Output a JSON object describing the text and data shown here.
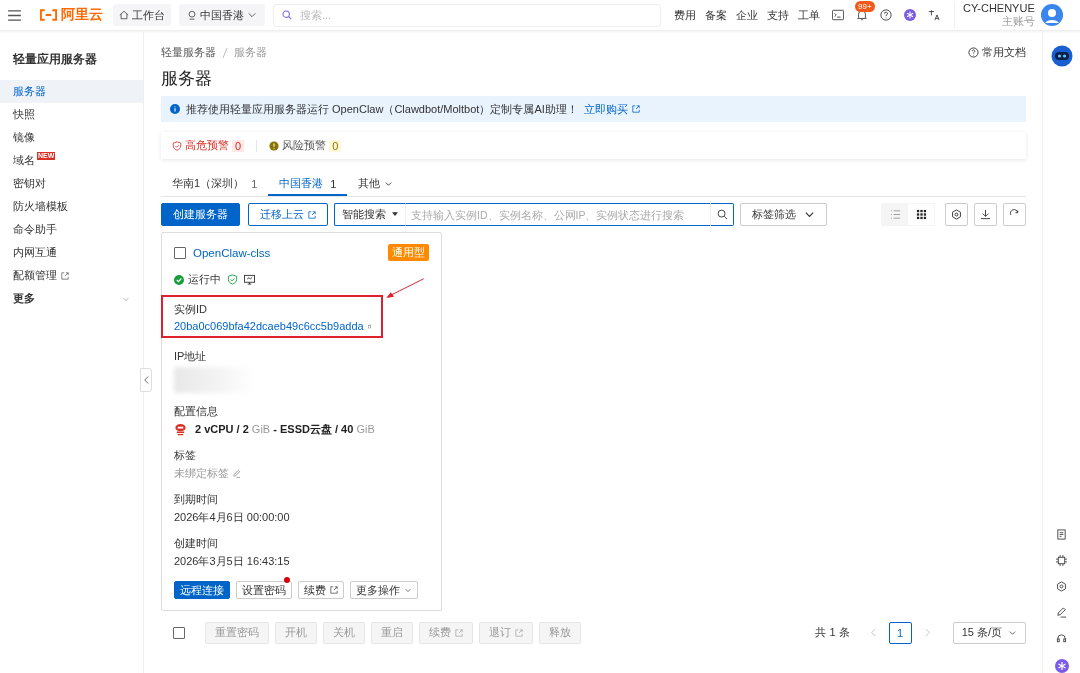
{
  "topbar": {
    "logo": "阿里云",
    "workbench": "工作台",
    "region": "中国香港",
    "search_placeholder": "搜索...",
    "links": [
      "费用",
      "备案",
      "企业",
      "支持",
      "工单"
    ],
    "notification_badge": "99+",
    "user": {
      "name": "CY-CHENYUE",
      "role": "主账号"
    }
  },
  "sidebar": {
    "title": "轻量应用服务器",
    "items": [
      {
        "label": "服务器",
        "selected": true
      },
      {
        "label": "快照",
        "selected": false
      },
      {
        "label": "镜像",
        "selected": false
      },
      {
        "label": "域名",
        "selected": false,
        "badge": "NEW"
      },
      {
        "label": "密钥对",
        "selected": false
      },
      {
        "label": "防火墙模板",
        "selected": false
      },
      {
        "label": "命令助手",
        "selected": false
      },
      {
        "label": "内网互通",
        "selected": false
      },
      {
        "label": "配额管理",
        "selected": false,
        "external": true
      }
    ],
    "more": "更多"
  },
  "breadcrumb": [
    "轻量服务器",
    "服务器"
  ],
  "page_title": "服务器",
  "docs_link": "常用文档",
  "notice": {
    "text": "推荐使用轻量应用服务器运行 OpenClaw（Clawdbot/Moltbot）定制专属AI助理！",
    "link": "立即购买"
  },
  "alerts": [
    {
      "kind": "danger",
      "label": "高危预警",
      "count": "0"
    },
    {
      "kind": "risk",
      "label": "风险预警",
      "count": "0"
    }
  ],
  "region_tabs": [
    {
      "kind": "region",
      "label": "华南1（深圳）",
      "count": "1",
      "selected": false
    },
    {
      "kind": "region",
      "label": "中国香港",
      "count": "1",
      "selected": true
    },
    {
      "kind": "dropdown",
      "label": "其他",
      "selected": false
    }
  ],
  "toolbar": {
    "create": "创建服务器",
    "migrate": "迁移上云",
    "search_mode": "智能搜索",
    "search_placeholder": "支持输入实例ID、实例名称、公网IP、实例状态进行搜索",
    "tag_filter": "标签筛选",
    "views": [
      {
        "kind": "list",
        "selected": false
      },
      {
        "kind": "grid",
        "selected": true
      }
    ]
  },
  "card": {
    "checked": false,
    "name": "OpenClaw-clss",
    "type_tag": "通用型",
    "status": "运行中",
    "instance_id_label": "实例ID",
    "instance_id": "20ba0c069bfa42dcaeb49c6cc5b9adda",
    "ip_label": "IP地址",
    "config_label": "配置信息",
    "config": "**2 vCPU / 2** GiB **- ESSD云盘 / 40** GiB",
    "tags_label": "标签",
    "tags_value": "未绑定标签",
    "expire_label": "到期时间",
    "expire": "2026年4月6日 00:00:00",
    "created_label": "创建时间",
    "created": "2026年3月5日 16:43:15",
    "buttons": [
      {
        "kind": "primary",
        "label": "远程连接"
      },
      {
        "kind": "notified",
        "label": "设置密码"
      },
      {
        "kind": "external",
        "label": "续费"
      },
      {
        "kind": "dropdown",
        "label": "更多操作"
      }
    ]
  },
  "select_all": {
    "checked": false
  },
  "bulk_actions": [
    {
      "label": "重置密码",
      "disabled": true,
      "external": false
    },
    {
      "label": "开机",
      "disabled": true,
      "external": false
    },
    {
      "label": "关机",
      "disabled": true,
      "external": false
    },
    {
      "label": "重启",
      "disabled": true,
      "external": false
    },
    {
      "label": "续费",
      "disabled": true,
      "external": true
    },
    {
      "label": "退订",
      "disabled": true,
      "external": true
    },
    {
      "label": "释放",
      "disabled": true,
      "external": false
    }
  ],
  "pagination": {
    "total": "共 1 条",
    "pages": [
      {
        "label": "1",
        "selected": true
      }
    ],
    "page_size": "15 条/页"
  }
}
